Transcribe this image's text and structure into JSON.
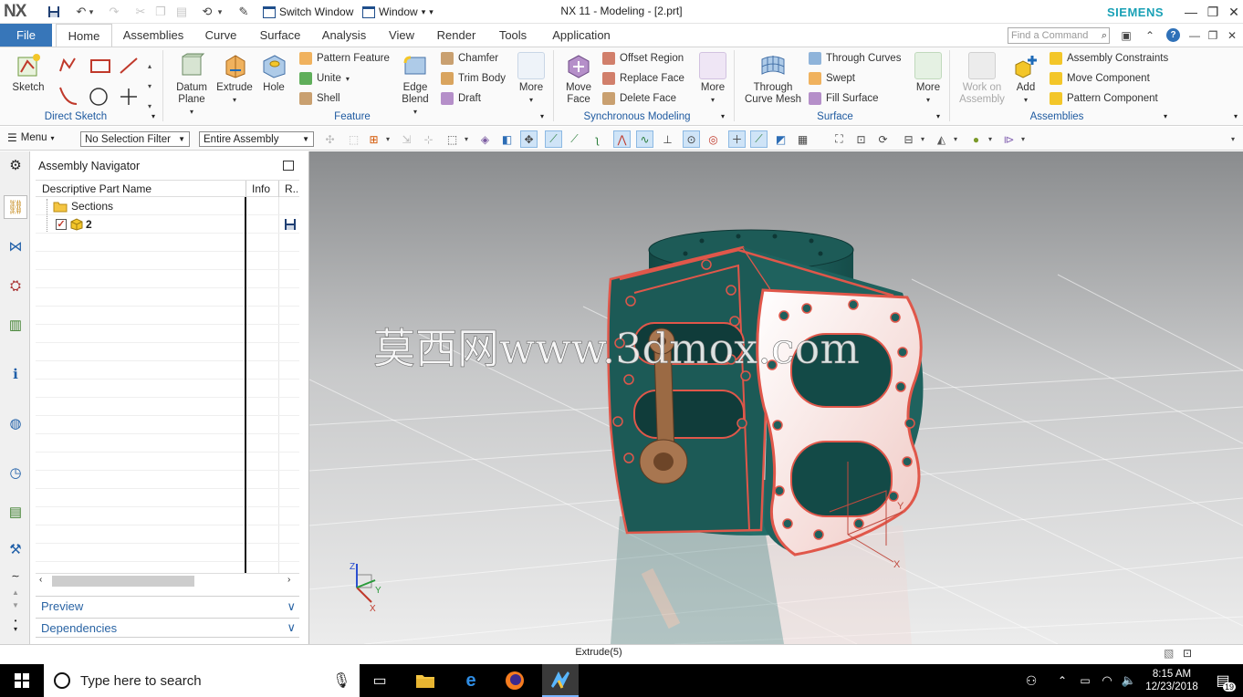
{
  "titlebar": {
    "logo": "NX",
    "switch_window": "Switch Window",
    "window_menu": "Window",
    "doc_title": "NX 11 - Modeling - [2.prt]",
    "brand": "SIEMENS"
  },
  "tabs": {
    "file": "File",
    "items": [
      "Home",
      "Assemblies",
      "Curve",
      "Surface",
      "Analysis",
      "View",
      "Render",
      "Tools",
      "Application"
    ],
    "active": "Home",
    "find_placeholder": "Find a Command"
  },
  "ribbon": {
    "direct_sketch": {
      "group": "Direct Sketch",
      "sketch": "Sketch"
    },
    "feature": {
      "group": "Feature",
      "datum_plane": "Datum Plane",
      "extrude": "Extrude",
      "hole": "Hole",
      "pattern_feature": "Pattern Feature",
      "unite": "Unite",
      "shell": "Shell",
      "edge_blend": "Edge Blend",
      "chamfer": "Chamfer",
      "trim_body": "Trim Body",
      "draft": "Draft",
      "more": "More"
    },
    "sync": {
      "group": "Synchronous Modeling",
      "move_face": "Move Face",
      "offset_region": "Offset Region",
      "replace_face": "Replace Face",
      "delete_face": "Delete Face",
      "more": "More"
    },
    "surface": {
      "group": "Surface",
      "through_curve_mesh": "Through Curve Mesh",
      "through_curves": "Through Curves",
      "swept": "Swept",
      "fill_surface": "Fill Surface",
      "more": "More"
    },
    "assemblies": {
      "group": "Assemblies",
      "work_on_assembly": "Work on Assembly",
      "add": "Add",
      "assembly_constraints": "Assembly Constraints",
      "move_component": "Move Component",
      "pattern_component": "Pattern Component"
    }
  },
  "toolbar": {
    "menu": "Menu",
    "selection_filter": "No Selection Filter",
    "scope": "Entire Assembly"
  },
  "navigator": {
    "title": "Assembly Navigator",
    "columns": [
      "Descriptive Part Name",
      "Info",
      "R..."
    ],
    "rows": [
      {
        "name": "Sections"
      },
      {
        "name": "2",
        "checked": true
      }
    ],
    "preview": "Preview",
    "dependencies": "Dependencies"
  },
  "graphics": {
    "watermark": "莫西网www.3dmox.com",
    "axis_labels": {
      "x": "X",
      "y": "Y",
      "z": "Z"
    },
    "colors": {
      "body": "#1f5f5c",
      "highlight": "#e0574a",
      "plate": "#f4d4d0",
      "rod": "#9b6a44"
    }
  },
  "status": {
    "message": "Extrude(5)"
  },
  "taskbar": {
    "search_placeholder": "Type here to search",
    "time": "8:15 AM",
    "date": "12/23/2018",
    "notifications": "19"
  }
}
